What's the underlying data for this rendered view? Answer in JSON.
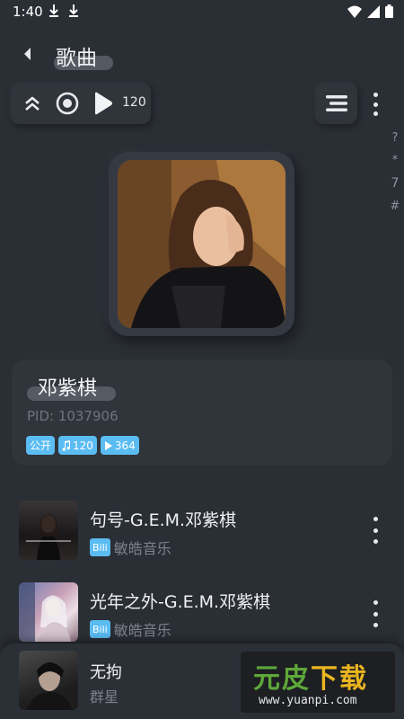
{
  "status_bar": {
    "time": "1:40"
  },
  "header": {
    "title": "歌曲"
  },
  "toolbar": {
    "play_count": "120"
  },
  "side_index": [
    "?",
    "*",
    "7",
    "#"
  ],
  "artist": {
    "name": "邓紫棋",
    "pid": "PID: 1037906",
    "tags": {
      "public": "公开",
      "songs": "120",
      "plays": "364"
    }
  },
  "songs": [
    {
      "title": "句号-G.E.M.邓紫棋",
      "source": "Bili",
      "uploader": "敏皓音乐"
    },
    {
      "title": "光年之外-G.E.M.邓紫棋",
      "source": "Bili",
      "uploader": "敏皓音乐"
    }
  ],
  "now_playing": {
    "title": "无拘",
    "artist": "群星"
  },
  "watermark": {
    "logo_a": "元皮",
    "logo_b": "下载",
    "url": "www.yuanpi.com"
  },
  "colors": {
    "background": "#2a2e35",
    "card": "#30343b",
    "tag": "#5bbcf2"
  }
}
